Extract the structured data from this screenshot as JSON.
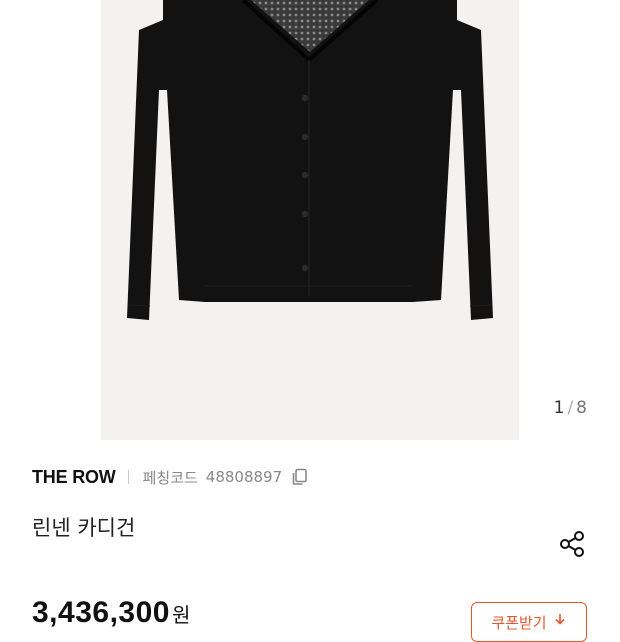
{
  "gallery": {
    "image_alt": "black V-neck cardigan product photo",
    "current": "1",
    "separator": "/",
    "total": "8"
  },
  "product": {
    "brand": "THE ROW",
    "code_label": "페칭코드",
    "code_value": "48808897",
    "title": "린넨 카디건"
  },
  "price": {
    "amount": "3,436,300",
    "unit": "원"
  },
  "coupon": {
    "label": "쿠폰받기",
    "icon": "download-icon"
  },
  "icons": {
    "copy": "copy-icon",
    "share": "share-icon"
  },
  "colors": {
    "accent": "#e4572e",
    "photo_bg": "#f3f2f1",
    "garment": "#121212"
  }
}
